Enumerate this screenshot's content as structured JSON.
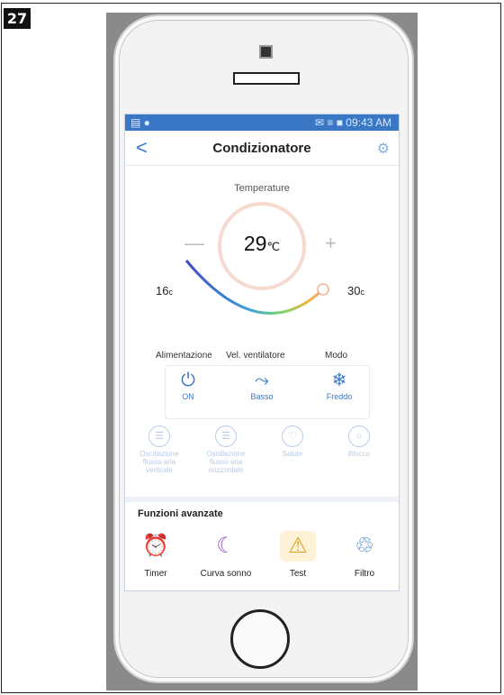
{
  "figure": {
    "number": "27"
  },
  "status_bar": {
    "time": "09:43 AM",
    "signal": "✉ ≡ ■"
  },
  "header": {
    "back_symbol": "<",
    "title": "Condizionatore"
  },
  "temperature": {
    "label": "Temperature",
    "value": "29",
    "unit": "℃",
    "minus": "—",
    "plus": "+",
    "min": "16",
    "min_unit": "c",
    "max": "30",
    "max_unit": "c"
  },
  "controls": [
    {
      "heading": "Alimentazione",
      "icon": "power-icon",
      "glyph": "⏻",
      "value": "ON"
    },
    {
      "heading": "Vel. ventilatore",
      "icon": "fan-speed-icon",
      "glyph": "⤳",
      "value": "Basso"
    },
    {
      "heading": "Modo",
      "icon": "snowflake-icon",
      "glyph": "❄",
      "value": "Freddo"
    }
  ],
  "oscillation": [
    {
      "label": "Oscillazione flusso aria verticale",
      "glyph": "☰"
    },
    {
      "label": "Oscillazione flusso aria orizzontale",
      "glyph": "☰"
    },
    {
      "label": "Salute",
      "glyph": "♡"
    },
    {
      "label": "Blocco",
      "glyph": "○"
    }
  ],
  "advanced": {
    "title": "Funzioni avanzate",
    "items": [
      {
        "label": "Timer",
        "icon": "alarm-clock-icon",
        "glyph": "⏰",
        "color": "#3a78c6"
      },
      {
        "label": "Curva sonno",
        "icon": "moon-icon",
        "glyph": "☾",
        "color": "#9b59b6"
      },
      {
        "label": "Test",
        "icon": "warning-icon",
        "glyph": "⚠",
        "color": "#e0a020"
      },
      {
        "label": "Filtro",
        "icon": "filter-icon",
        "glyph": "♲",
        "color": "#3a78c6"
      }
    ]
  }
}
